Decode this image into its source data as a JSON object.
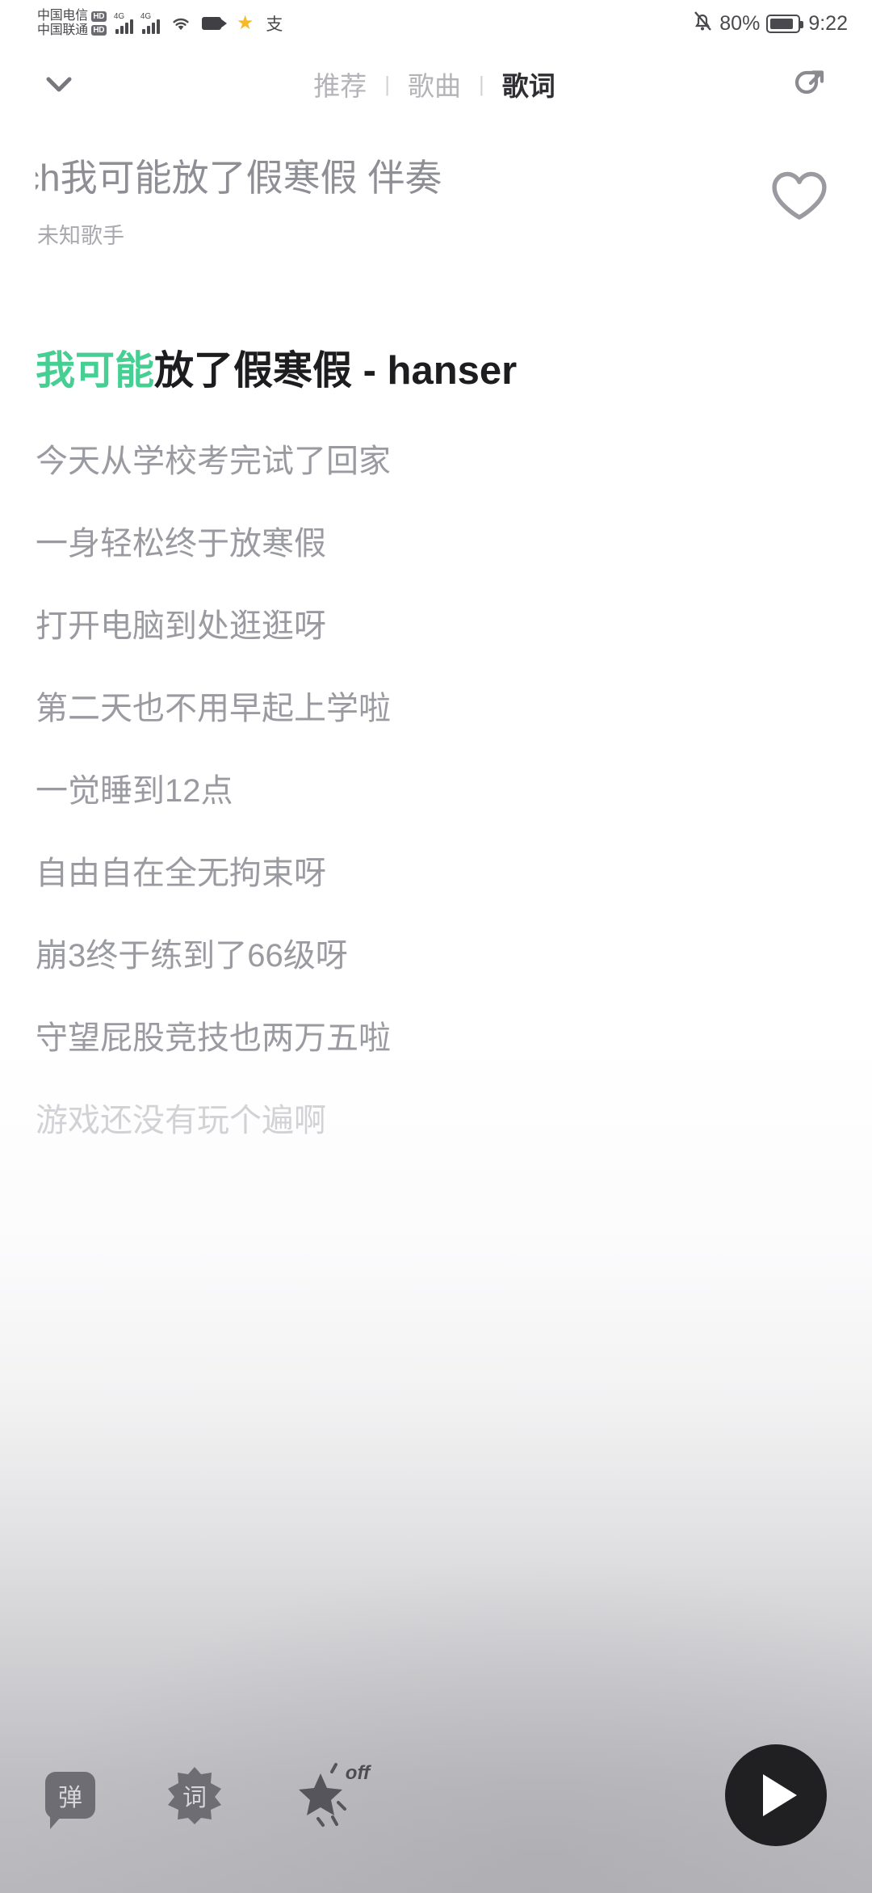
{
  "status_bar": {
    "carrier_1": "中国电信",
    "carrier_1_badge": "HD",
    "carrier_2": "中国联通",
    "carrier_2_badge": "HD",
    "network_1": "4G",
    "network_2": "4G",
    "icons": [
      "signal-bars-icon",
      "signal-bars-icon",
      "wifi-icon",
      "video-camera-icon",
      "star-icon",
      "alipay-icon",
      "mute-bell-icon"
    ],
    "battery_percent": "80%",
    "time": "9:22"
  },
  "nav": {
    "collapse_icon": "chevron-down-icon",
    "tabs": [
      {
        "label": "推荐",
        "active": false
      },
      {
        "label": "歌曲",
        "active": false
      },
      {
        "label": "歌词",
        "active": true
      }
    ],
    "separator": "|",
    "share_icon": "share-icon"
  },
  "song": {
    "title": "ch我可能放了假寒假 伴奏",
    "artist": "未知歌手",
    "favorite_icon": "heart-outline-icon",
    "favorited": false
  },
  "lyrics": {
    "current_line": {
      "sung_text": "我可能",
      "unsung_text": "放了假寒假 - hanser"
    },
    "lines": [
      {
        "text": "今天从学校考完试了回家",
        "faded": false
      },
      {
        "text": "一身轻松终于放寒假",
        "faded": false
      },
      {
        "text": "打开电脑到处逛逛呀",
        "faded": false
      },
      {
        "text": "第二天也不用早起上学啦",
        "faded": false
      },
      {
        "text": "一觉睡到12点",
        "faded": false
      },
      {
        "text": "自由自在全无拘束呀",
        "faded": false
      },
      {
        "text": "崩3终于练到了66级呀",
        "faded": false
      },
      {
        "text": "守望屁股竞技也两万五啦",
        "faded": false
      },
      {
        "text": "游戏还没有玩个遍啊",
        "faded": true
      }
    ]
  },
  "bottom_bar": {
    "danmaku_label": "弹",
    "lyrics_label": "词",
    "effect_label": "off",
    "play_icon": "play-icon"
  },
  "colors": {
    "karaoke_green": "#45cf92",
    "active_lyric": "#1d1d1f",
    "inactive_lyric": "#9a9aa1",
    "play_button": "#201f22"
  }
}
